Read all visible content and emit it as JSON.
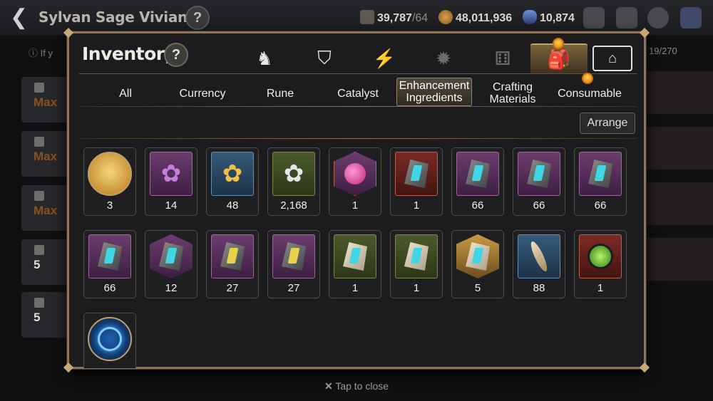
{
  "header": {
    "back_icon": "back-arrow-icon",
    "hero_name": "Sylvan Sage Vivian",
    "help_glyph": "?",
    "stamina_value": "39,787",
    "stamina_max": "/64",
    "gold_value": "48,011,936",
    "crystal_value": "10,874"
  },
  "background": {
    "item_count": "19/270",
    "max_labels": [
      "Max",
      "Max",
      "Max"
    ],
    "level_labels": [
      "5",
      "5"
    ]
  },
  "inventory": {
    "title": "Inventory",
    "help_glyph": "?",
    "category_icons": [
      {
        "name": "equipment-icon",
        "glyph": "♞"
      },
      {
        "name": "broken-shield-icon",
        "glyph": "⛉"
      },
      {
        "name": "lightning-icon",
        "glyph": "⚡"
      },
      {
        "name": "artifact-icon",
        "glyph": "✹"
      },
      {
        "name": "dice-icon",
        "glyph": "⚅"
      },
      {
        "name": "backpack-icon",
        "glyph": "🎒"
      },
      {
        "name": "storage-icon",
        "glyph": "⌂"
      }
    ],
    "tabs": [
      {
        "label": "All"
      },
      {
        "label": "Currency"
      },
      {
        "label": "Rune"
      },
      {
        "label": "Catalyst"
      },
      {
        "label_line1": "Enhancement",
        "label_line2": "Ingredients",
        "active": true
      },
      {
        "label_line1": "Crafting",
        "label_line2": "Materials"
      },
      {
        "label": "Consumable"
      }
    ],
    "arrange_label": "Arrange",
    "items": [
      {
        "count": "3",
        "frame": "circle",
        "icon": "hero-portrait-icon"
      },
      {
        "count": "14",
        "frame": "purple",
        "icon": "purple-flower-icon"
      },
      {
        "count": "48",
        "frame": "blue",
        "icon": "gold-flower-icon"
      },
      {
        "count": "2,168",
        "frame": "green",
        "icon": "silver-flower-icon"
      },
      {
        "count": "1",
        "frame": "hexred",
        "icon": "potion-icon"
      },
      {
        "count": "1",
        "frame": "red",
        "icon": "charm-stone-icon"
      },
      {
        "count": "66",
        "frame": "purple",
        "icon": "rune-stone-icon"
      },
      {
        "count": "66",
        "frame": "purple",
        "icon": "rune-stone-icon"
      },
      {
        "count": "66",
        "frame": "purple",
        "icon": "rune-stone-icon"
      },
      {
        "count": "66",
        "frame": "purple",
        "icon": "rune-stone-icon"
      },
      {
        "count": "12",
        "frame": "hexpurple",
        "icon": "rune-stone-icon"
      },
      {
        "count": "27",
        "frame": "purple",
        "icon": "rune-stone-icon"
      },
      {
        "count": "27",
        "frame": "purple",
        "icon": "rune-stone-icon"
      },
      {
        "count": "1",
        "frame": "green",
        "icon": "light-rune-stone-icon"
      },
      {
        "count": "1",
        "frame": "green",
        "icon": "light-rune-stone-icon"
      },
      {
        "count": "5",
        "frame": "hexgold",
        "icon": "light-rune-stone-icon"
      },
      {
        "count": "88",
        "frame": "blue",
        "icon": "feather-icon"
      },
      {
        "count": "1",
        "frame": "red",
        "icon": "green-orb-icon"
      },
      {
        "count": "",
        "frame": "circleblue",
        "icon": "blue-sigil-icon"
      }
    ]
  },
  "footer": {
    "close_icon": "close-x-icon",
    "close_label": "Tap to close"
  },
  "colors": {
    "gold_border": "#8d7658",
    "active_tab": "#51493a",
    "count_text": "#f2f0ec"
  }
}
